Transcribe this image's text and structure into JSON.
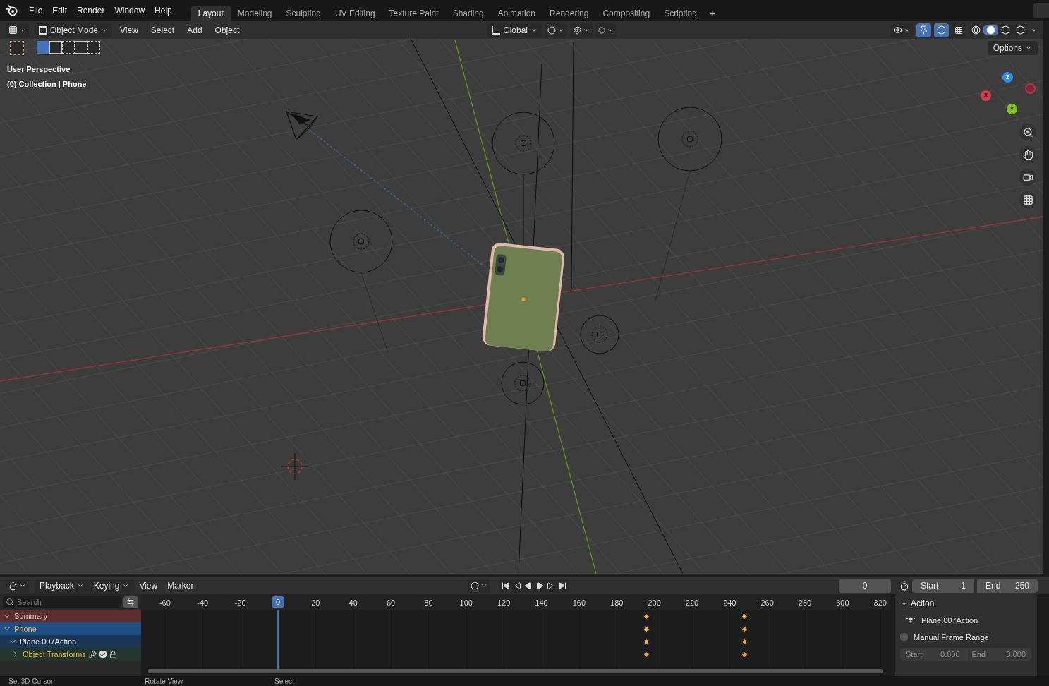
{
  "menu": [
    "File",
    "Edit",
    "Render",
    "Window",
    "Help"
  ],
  "workspaces": [
    {
      "label": "Layout",
      "selected": true
    },
    {
      "label": "Modeling",
      "selected": false
    },
    {
      "label": "Sculpting",
      "selected": false
    },
    {
      "label": "UV Editing",
      "selected": false
    },
    {
      "label": "Texture Paint",
      "selected": false
    },
    {
      "label": "Shading",
      "selected": false
    },
    {
      "label": "Animation",
      "selected": false
    },
    {
      "label": "Rendering",
      "selected": false
    },
    {
      "label": "Compositing",
      "selected": false
    },
    {
      "label": "Scripting",
      "selected": false
    }
  ],
  "add_workspace": "+",
  "viewport_header": {
    "mode": "Object Mode",
    "menus": [
      "View",
      "Select",
      "Add",
      "Object"
    ],
    "orientation": "Global"
  },
  "overlay_text": [
    "User Perspective",
    "(0) Collection | Phone"
  ],
  "options_button": "Options",
  "gizmo": {
    "x": "X",
    "y": "Y",
    "z": "Z"
  },
  "timeline": {
    "menus": [
      {
        "label": "Playback",
        "dropdown": true
      },
      {
        "label": "Keying",
        "dropdown": true
      },
      {
        "label": "View",
        "dropdown": false
      },
      {
        "label": "Marker",
        "dropdown": false
      }
    ],
    "current_frame": "0",
    "start_label": "Start",
    "start": "1",
    "end_label": "End",
    "end": "250",
    "search_placeholder": "Search",
    "ruler": [
      {
        "label": "-60",
        "selected": false
      },
      {
        "label": "-40",
        "selected": false
      },
      {
        "label": "-20",
        "selected": false
      },
      {
        "label": "0",
        "selected": true
      },
      {
        "label": "20",
        "selected": false
      },
      {
        "label": "40",
        "selected": false
      },
      {
        "label": "60",
        "selected": false
      },
      {
        "label": "80",
        "selected": false
      },
      {
        "label": "100",
        "selected": false
      },
      {
        "label": "120",
        "selected": false
      },
      {
        "label": "140",
        "selected": false
      },
      {
        "label": "160",
        "selected": false
      },
      {
        "label": "180",
        "selected": false
      },
      {
        "label": "200",
        "selected": false
      },
      {
        "label": "220",
        "selected": false
      },
      {
        "label": "240",
        "selected": false
      },
      {
        "label": "260",
        "selected": false
      },
      {
        "label": "280",
        "selected": false
      },
      {
        "label": "300",
        "selected": false
      },
      {
        "label": "320",
        "selected": false
      }
    ],
    "channels": [
      {
        "label": "Summary",
        "kind": "summary",
        "expanded": true
      },
      {
        "label": "Phone",
        "kind": "object",
        "expanded": true
      },
      {
        "label": "Plane.007Action",
        "kind": "action",
        "expanded": true
      },
      {
        "label": "Object Transforms",
        "kind": "group",
        "expanded": false,
        "checked": true
      }
    ]
  },
  "action_panel": {
    "title": "Action",
    "action_name": "Plane.007Action",
    "manual_frame_range": {
      "label": "Manual Frame Range",
      "checked": false
    },
    "start_label": "Start",
    "start": "0.000",
    "end_label": "End",
    "end": "0.000"
  },
  "status_bar": [
    "Set 3D Cursor",
    "Rotate View",
    "Select"
  ]
}
